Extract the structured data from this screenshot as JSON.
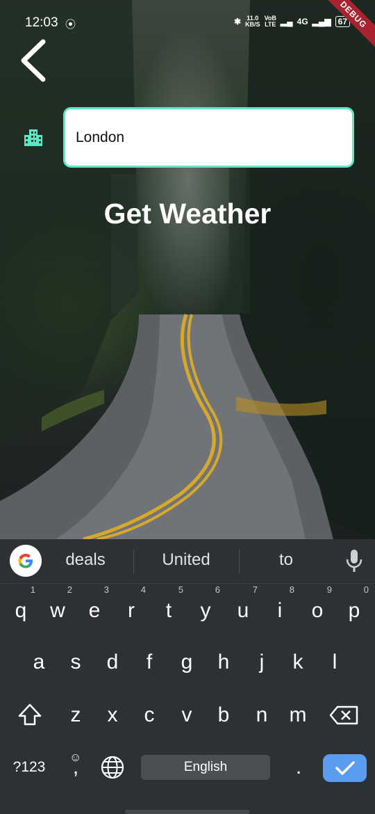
{
  "status_bar": {
    "time": "12:03",
    "network_speed_value": "11.0",
    "network_speed_unit": "KB/S",
    "volte_top": "VoB",
    "volte_bottom": "LTE",
    "network_type": "4G",
    "battery": "67",
    "debug_label": "DEBUG"
  },
  "search": {
    "city_value": "London"
  },
  "action": {
    "get_weather_label": "Get Weather"
  },
  "keyboard": {
    "suggestions": [
      "deals",
      "United",
      "to"
    ],
    "row1": [
      {
        "key": "q",
        "hint": "1"
      },
      {
        "key": "w",
        "hint": "2"
      },
      {
        "key": "e",
        "hint": "3"
      },
      {
        "key": "r",
        "hint": "4"
      },
      {
        "key": "t",
        "hint": "5"
      },
      {
        "key": "y",
        "hint": "6"
      },
      {
        "key": "u",
        "hint": "7"
      },
      {
        "key": "i",
        "hint": "8"
      },
      {
        "key": "o",
        "hint": "9"
      },
      {
        "key": "p",
        "hint": "0"
      }
    ],
    "row2": [
      "a",
      "s",
      "d",
      "f",
      "g",
      "h",
      "j",
      "k",
      "l"
    ],
    "row3": [
      "z",
      "x",
      "c",
      "v",
      "b",
      "n",
      "m"
    ],
    "symbols_label": "?123",
    "comma_label": ",",
    "space_label": "English",
    "period_label": ".",
    "accent_color": "#5b9cf3"
  },
  "colors": {
    "input_border": "#5ee7c4",
    "city_icon": "#5ee7c4",
    "debug_banner": "#a6232f"
  }
}
